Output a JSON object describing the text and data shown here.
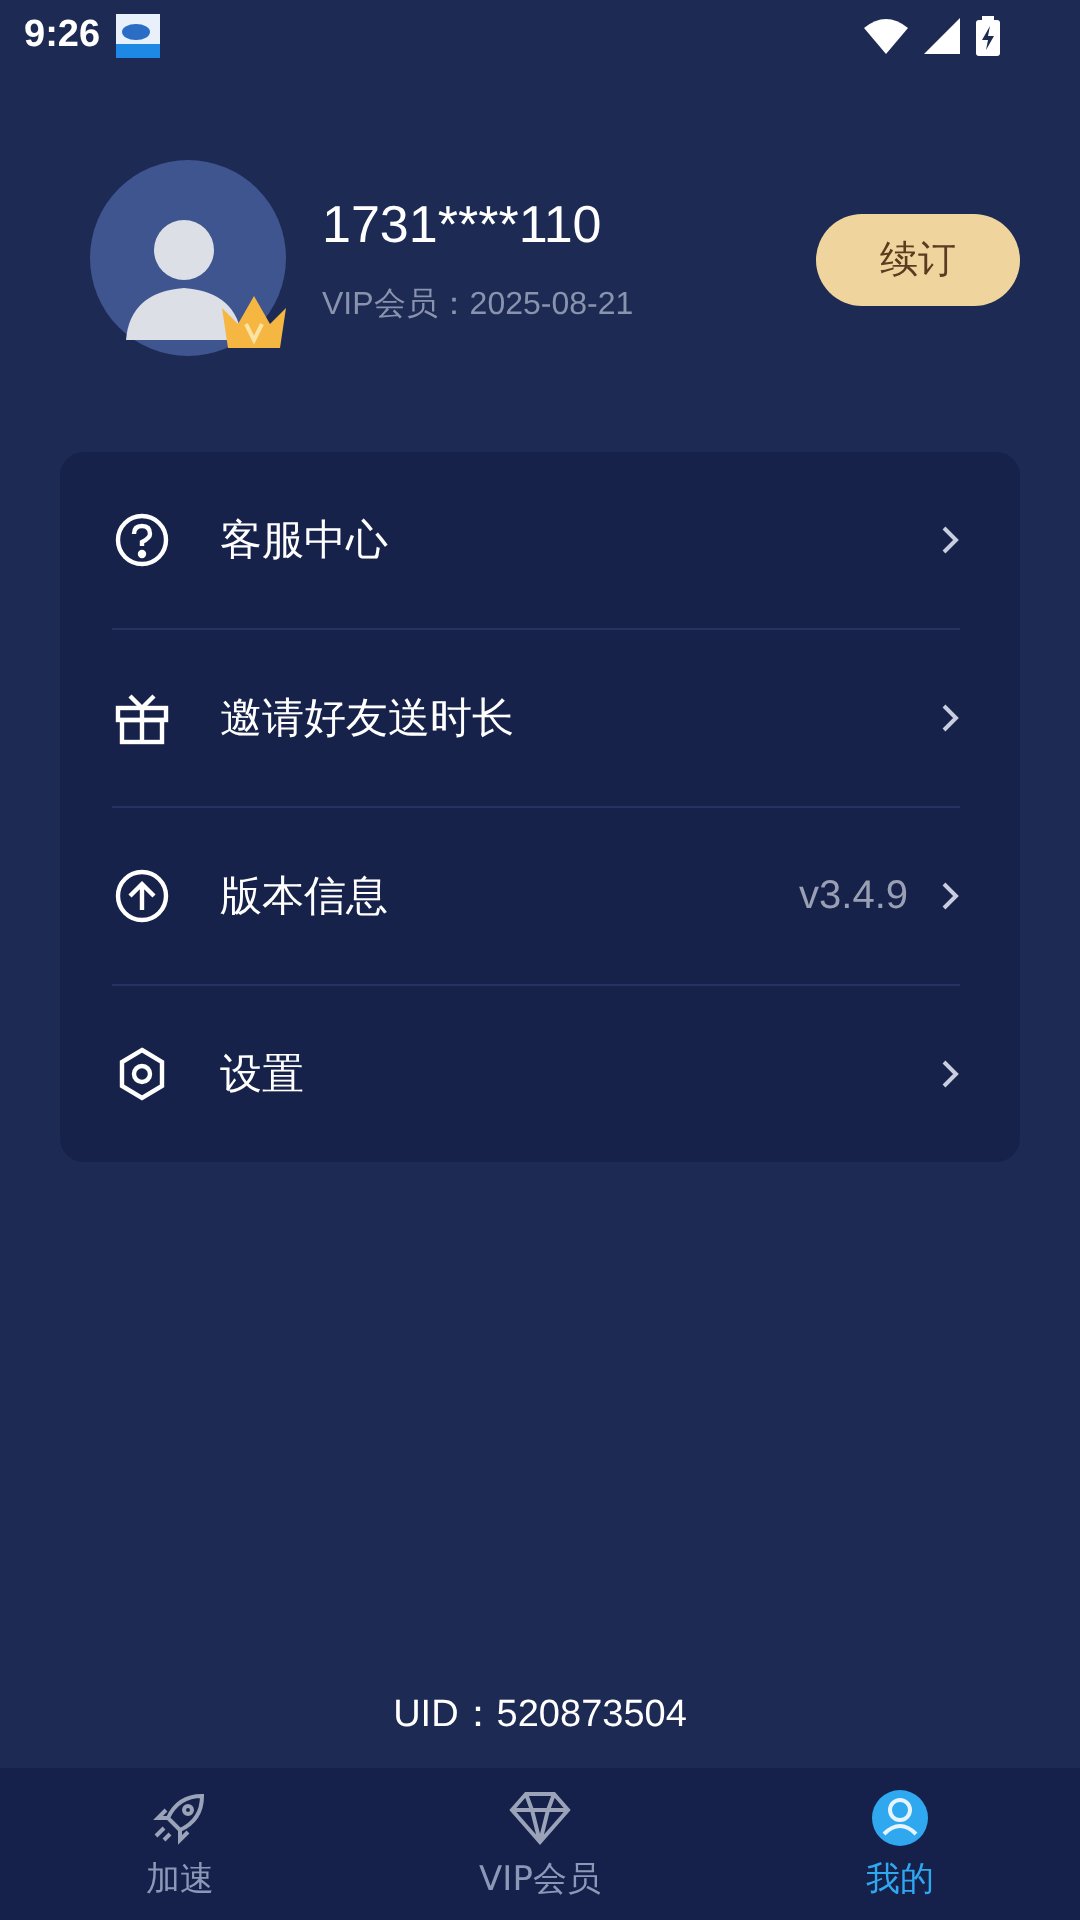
{
  "status_bar": {
    "time": "9:26"
  },
  "profile": {
    "phone": "1731****110",
    "vip_line": "VIP会员：2025-08-21",
    "renew_button": "续订",
    "vip": true
  },
  "menu": [
    {
      "kind": "help",
      "label": "客服中心"
    },
    {
      "kind": "gift",
      "label": "邀请好友送时长"
    },
    {
      "kind": "upgrade",
      "label": "版本信息",
      "value": "v3.4.9"
    },
    {
      "kind": "settings",
      "label": "设置"
    }
  ],
  "uid": "UID：520873504",
  "tabs": [
    {
      "kind": "rocket",
      "label": "加速",
      "selected": false
    },
    {
      "kind": "diamond",
      "label": "VIP会员",
      "selected": false
    },
    {
      "kind": "person",
      "label": "我的",
      "selected": true
    }
  ]
}
